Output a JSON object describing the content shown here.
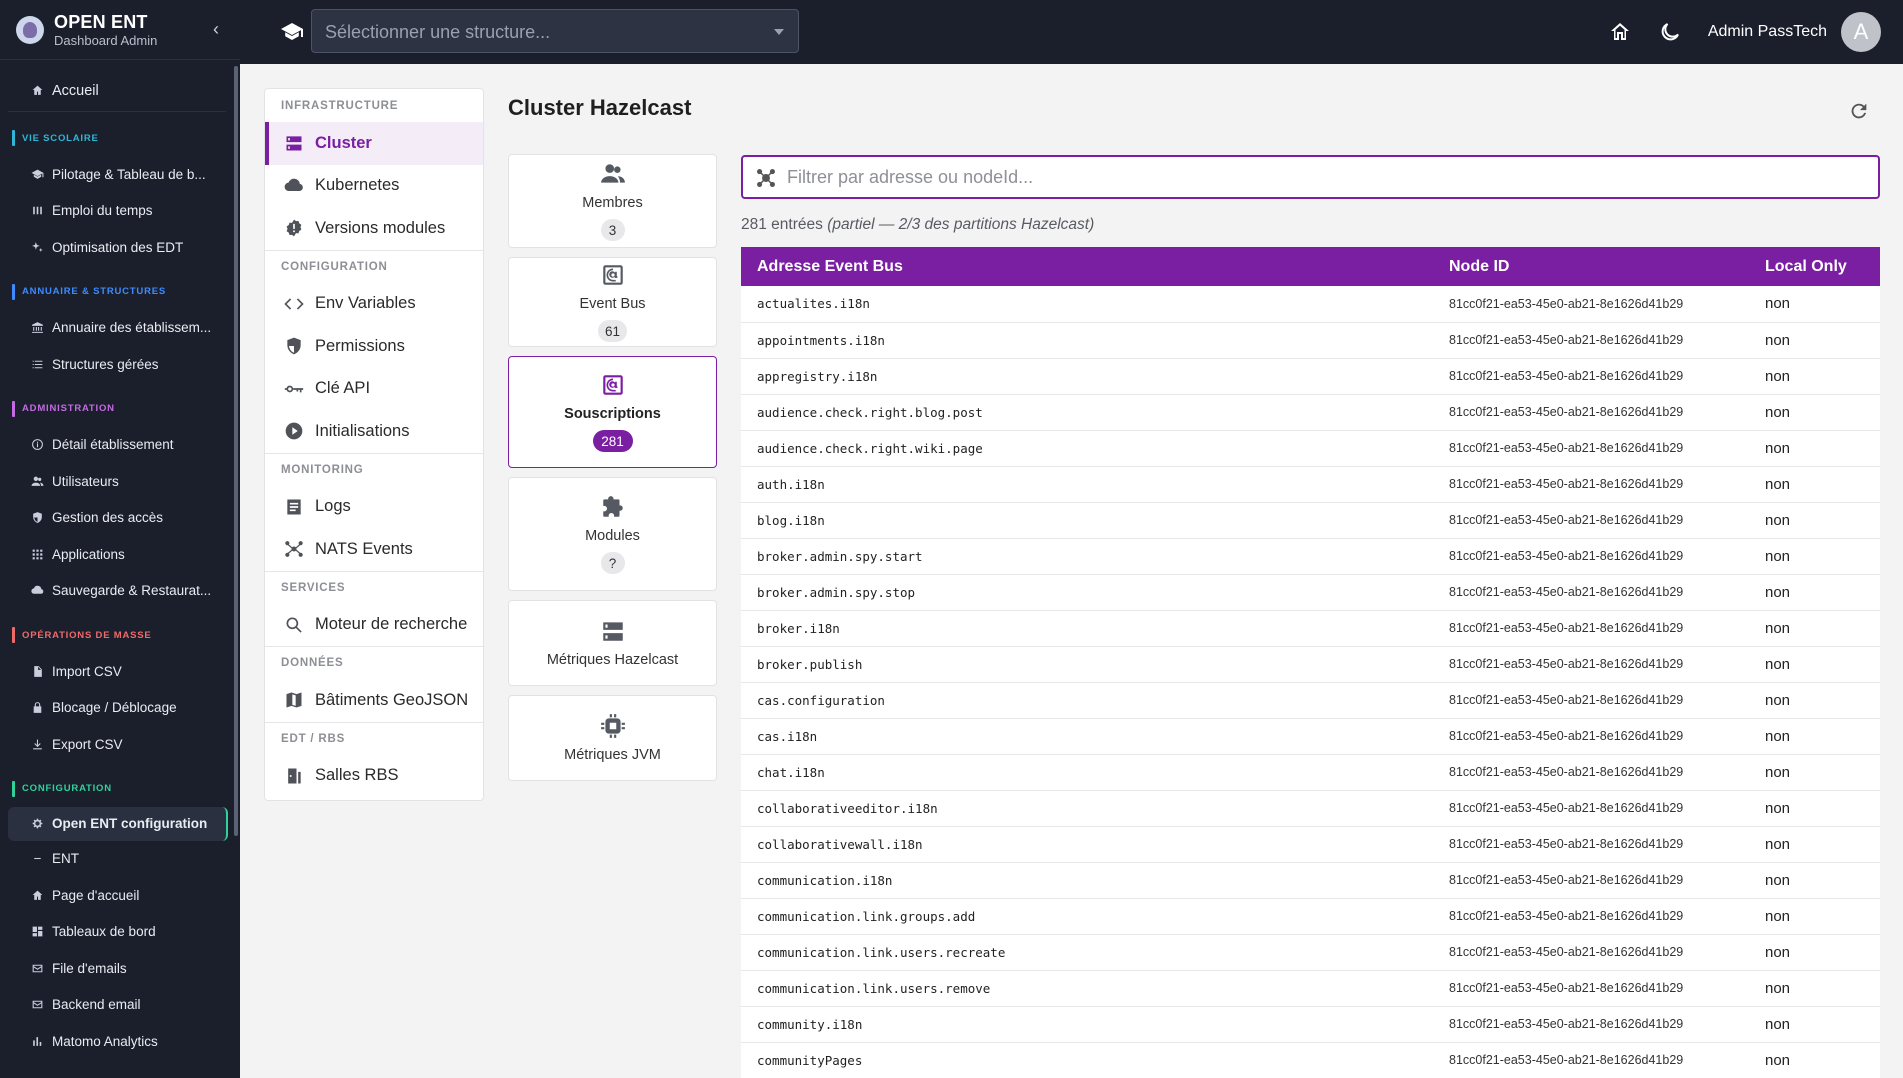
{
  "brand": {
    "title": "OPEN ENT",
    "subtitle": "Dashboard Admin"
  },
  "sidebar": {
    "home": "Accueil",
    "sections": [
      {
        "label": "VIE SCOLAIRE",
        "color": "#2fb6d6",
        "items": [
          {
            "label": "Pilotage & Tableau de b...",
            "icon": "cap-icon"
          },
          {
            "label": "Emploi du temps",
            "icon": "bars-icon"
          },
          {
            "label": "Optimisation des EDT",
            "icon": "sparkle-icon"
          }
        ]
      },
      {
        "label": "ANNUAIRE & STRUCTURES",
        "color": "#3d8bff",
        "items": [
          {
            "label": "Annuaire des établissem...",
            "icon": "bank-icon"
          },
          {
            "label": "Structures gérées",
            "icon": "list-icon"
          }
        ]
      },
      {
        "label": "ADMINISTRATION",
        "color": "#c46be3",
        "items": [
          {
            "label": "Détail établissement",
            "icon": "info-icon"
          },
          {
            "label": "Utilisateurs",
            "icon": "users-icon"
          },
          {
            "label": "Gestion des accès",
            "icon": "shield-icon"
          },
          {
            "label": "Applications",
            "icon": "grid-icon"
          },
          {
            "label": "Sauvegarde & Restaurat...",
            "icon": "cloud-icon"
          }
        ]
      },
      {
        "label": "OPÉRATIONS DE MASSE",
        "color": "#f06a6a",
        "items": [
          {
            "label": "Import CSV",
            "icon": "file-icon"
          },
          {
            "label": "Blocage / Déblocage",
            "icon": "lock-icon"
          },
          {
            "label": "Export CSV",
            "icon": "download-icon"
          }
        ]
      },
      {
        "label": "CONFIGURATION",
        "color": "#2fd39a",
        "items": [
          {
            "label": "Open ENT configuration",
            "icon": "gear-icon",
            "active": true
          },
          {
            "label": "ENT",
            "icon": "minus-icon"
          },
          {
            "label": "Page d'accueil",
            "icon": "home-icon"
          },
          {
            "label": "Tableaux de bord",
            "icon": "dashboard-icon"
          },
          {
            "label": "File d'emails",
            "icon": "mail-icon"
          },
          {
            "label": "Backend email",
            "icon": "mail-icon"
          },
          {
            "label": "Matomo Analytics",
            "icon": "chart-icon"
          }
        ]
      }
    ]
  },
  "topbar": {
    "structure_placeholder": "Sélectionner une structure...",
    "user_name": "Admin PassTech",
    "avatar_letter": "A"
  },
  "config_nav": [
    {
      "section": "INFRASTRUCTURE",
      "items": [
        {
          "label": "Cluster",
          "icon": "server-icon",
          "active": true
        },
        {
          "label": "Kubernetes",
          "icon": "cloud-icon"
        },
        {
          "label": "Versions modules",
          "icon": "badge-alert-icon"
        }
      ]
    },
    {
      "section": "CONFIGURATION",
      "items": [
        {
          "label": "Env Variables",
          "icon": "code-icon"
        },
        {
          "label": "Permissions",
          "icon": "shield-icon"
        },
        {
          "label": "Clé API",
          "icon": "key-icon"
        },
        {
          "label": "Initialisations",
          "icon": "play-icon"
        }
      ]
    },
    {
      "section": "MONITORING",
      "items": [
        {
          "label": "Logs",
          "icon": "doc-icon"
        },
        {
          "label": "NATS Events",
          "icon": "hub-icon"
        }
      ]
    },
    {
      "section": "SERVICES",
      "items": [
        {
          "label": "Moteur de recherche",
          "icon": "search-icon"
        }
      ]
    },
    {
      "section": "DONNÉES",
      "items": [
        {
          "label": "Bâtiments GeoJSON",
          "icon": "map-icon"
        }
      ]
    },
    {
      "section": "EDT / RBS",
      "items": [
        {
          "label": "Salles RBS",
          "icon": "door-icon"
        }
      ]
    }
  ],
  "main": {
    "title": "Cluster Hazelcast",
    "cards": [
      {
        "label": "Membres",
        "badge": "3",
        "icon": "users-icon",
        "height": 94
      },
      {
        "label": "Event Bus",
        "badge": "61",
        "icon": "at-icon",
        "height": 90
      },
      {
        "label": "Souscriptions",
        "badge": "281",
        "icon": "at-icon",
        "height": 112,
        "active": true
      },
      {
        "label": "Modules",
        "badge": "?",
        "icon": "puzzle-icon",
        "height": 114
      },
      {
        "label": "Métriques Hazelcast",
        "badge": "",
        "icon": "server-icon",
        "height": 86
      },
      {
        "label": "Métriques JVM",
        "badge": "",
        "icon": "chip-icon",
        "height": 86
      }
    ],
    "filter_placeholder": "Filtrer par adresse ou nodeId...",
    "count_prefix": "281 entrées",
    "count_partial": "(partiel — 2/3 des partitions Hazelcast)",
    "table": {
      "headers": [
        "Adresse Event Bus",
        "Node ID",
        "Local Only"
      ],
      "rows": [
        [
          "actualites.i18n",
          "81cc0f21-ea53-45e0-ab21-8e1626d41b29",
          "non"
        ],
        [
          "appointments.i18n",
          "81cc0f21-ea53-45e0-ab21-8e1626d41b29",
          "non"
        ],
        [
          "appregistry.i18n",
          "81cc0f21-ea53-45e0-ab21-8e1626d41b29",
          "non"
        ],
        [
          "audience.check.right.blog.post",
          "81cc0f21-ea53-45e0-ab21-8e1626d41b29",
          "non"
        ],
        [
          "audience.check.right.wiki.page",
          "81cc0f21-ea53-45e0-ab21-8e1626d41b29",
          "non"
        ],
        [
          "auth.i18n",
          "81cc0f21-ea53-45e0-ab21-8e1626d41b29",
          "non"
        ],
        [
          "blog.i18n",
          "81cc0f21-ea53-45e0-ab21-8e1626d41b29",
          "non"
        ],
        [
          "broker.admin.spy.start",
          "81cc0f21-ea53-45e0-ab21-8e1626d41b29",
          "non"
        ],
        [
          "broker.admin.spy.stop",
          "81cc0f21-ea53-45e0-ab21-8e1626d41b29",
          "non"
        ],
        [
          "broker.i18n",
          "81cc0f21-ea53-45e0-ab21-8e1626d41b29",
          "non"
        ],
        [
          "broker.publish",
          "81cc0f21-ea53-45e0-ab21-8e1626d41b29",
          "non"
        ],
        [
          "cas.configuration",
          "81cc0f21-ea53-45e0-ab21-8e1626d41b29",
          "non"
        ],
        [
          "cas.i18n",
          "81cc0f21-ea53-45e0-ab21-8e1626d41b29",
          "non"
        ],
        [
          "chat.i18n",
          "81cc0f21-ea53-45e0-ab21-8e1626d41b29",
          "non"
        ],
        [
          "collaborativeeditor.i18n",
          "81cc0f21-ea53-45e0-ab21-8e1626d41b29",
          "non"
        ],
        [
          "collaborativewall.i18n",
          "81cc0f21-ea53-45e0-ab21-8e1626d41b29",
          "non"
        ],
        [
          "communication.i18n",
          "81cc0f21-ea53-45e0-ab21-8e1626d41b29",
          "non"
        ],
        [
          "communication.link.groups.add",
          "81cc0f21-ea53-45e0-ab21-8e1626d41b29",
          "non"
        ],
        [
          "communication.link.users.recreate",
          "81cc0f21-ea53-45e0-ab21-8e1626d41b29",
          "non"
        ],
        [
          "communication.link.users.remove",
          "81cc0f21-ea53-45e0-ab21-8e1626d41b29",
          "non"
        ],
        [
          "community.i18n",
          "81cc0f21-ea53-45e0-ab21-8e1626d41b29",
          "non"
        ],
        [
          "communityPages",
          "81cc0f21-ea53-45e0-ab21-8e1626d41b29",
          "non"
        ]
      ]
    }
  },
  "colors": {
    "accent": "#7b1fa2",
    "dark_bg": "#1b1f2c",
    "config_green": "#2fd39a"
  }
}
